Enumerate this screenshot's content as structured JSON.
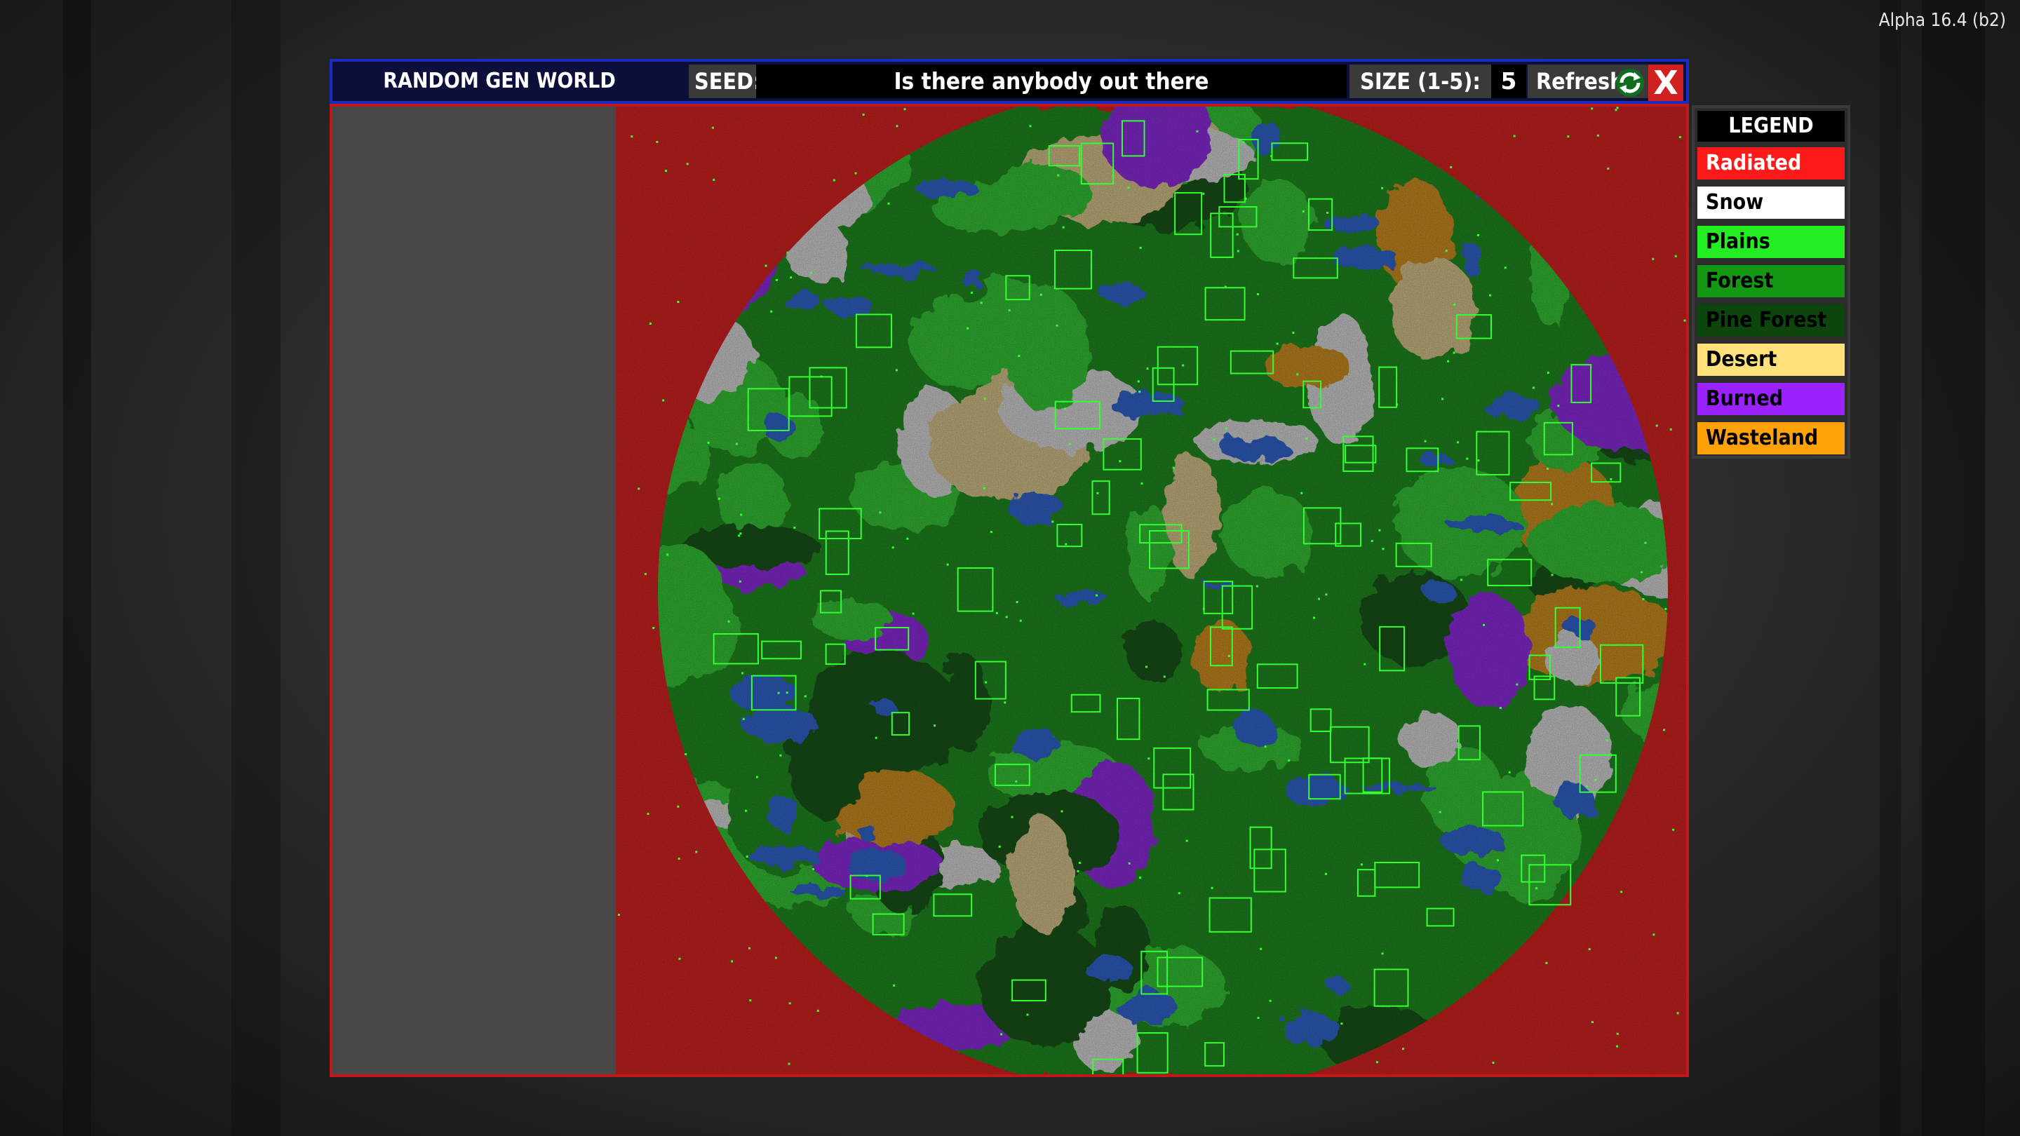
{
  "version": "Alpha 16.4 (b2)",
  "toolbar": {
    "title": "RANDOM GEN WORLD PREVIEWER",
    "seed_label": "SEED:",
    "seed_value": "Is there anybody out there",
    "size_label": "SIZE (1-5):",
    "size_value": "5",
    "refresh_label": "Refresh:",
    "close_label": "X"
  },
  "legend": {
    "title": "LEGEND",
    "items": [
      {
        "label": "Radiated",
        "bg": "#ff1a1a",
        "fg": "#ffffff"
      },
      {
        "label": "Snow",
        "bg": "#ffffff",
        "fg": "#000000"
      },
      {
        "label": "Plains",
        "bg": "#22ee22",
        "fg": "#000000"
      },
      {
        "label": "Forest",
        "bg": "#149814",
        "fg": "#000000"
      },
      {
        "label": "Pine Forest",
        "bg": "#0d460d",
        "fg": "#000000"
      },
      {
        "label": "Desert",
        "bg": "#ffe07a",
        "fg": "#000000"
      },
      {
        "label": "Burned Forest",
        "bg": "#9b22ff",
        "fg": "#000000"
      },
      {
        "label": "Wasteland",
        "bg": "#ffa20a",
        "fg": "#000000"
      }
    ]
  },
  "map": {
    "biome_colors": {
      "radiated": "#b81e1e",
      "snow": "#b8b8b8",
      "plains": "#2fa82f",
      "forest": "#1e781e",
      "pine_forest": "#154a15",
      "desert": "#b8a878",
      "burned_forest": "#7a26c0",
      "wasteland": "#b07a1e",
      "water": "#2a56b0",
      "town_marker": "#33ff33"
    }
  }
}
